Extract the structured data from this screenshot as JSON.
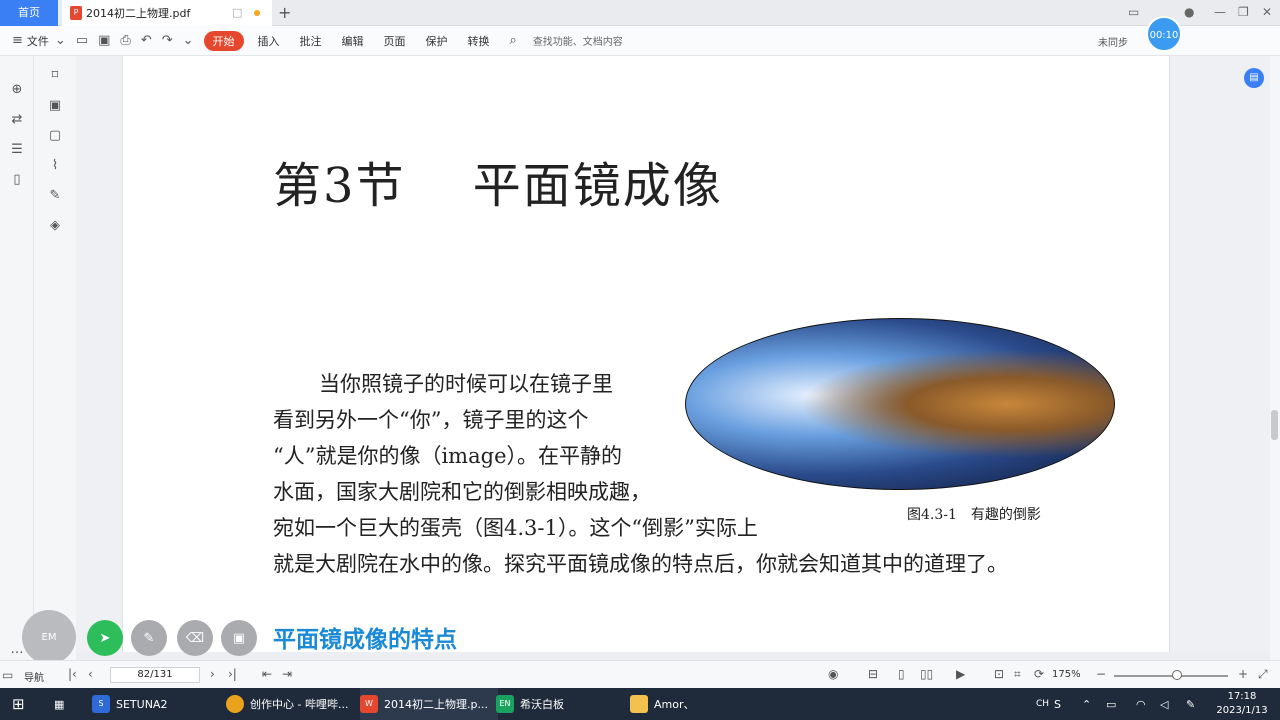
{
  "tabs": {
    "home": "首页",
    "document": "2014初二上物理.pdf"
  },
  "toolbar": {
    "file": "文件",
    "menu": [
      "开始",
      "插入",
      "批注",
      "编辑",
      "页面",
      "保护",
      "转换"
    ],
    "search_placeholder": "查找功能、文档内容",
    "sync": "未同步",
    "timer": "00:10"
  },
  "document": {
    "chapter_title": "第3节　 平面镜成像",
    "paragraph_lines": [
      "当你照镜子的时候可以在镜子里",
      "看到另外一个“你”，镜子里的这个",
      "“人”就是你的像（image）。在平静的",
      "水面，国家大剧院和它的倒影相映成趣，",
      "宛如一个巨大的蛋壳（图4.3-1）。这个“倒影”实际上",
      "就是大剧院在水中的像。探究平面镜成像的特点后，你就会知道其中的道理了。"
    ],
    "figure_caption": "图4.3-1　有趣的倒影",
    "section_heading": "平面镜成像的特点"
  },
  "statusbar": {
    "nav": "导航",
    "page": "82/131",
    "zoom": "175%"
  },
  "taskbar": {
    "items": [
      "SETUNA2",
      "创作中心 - 哔哩哔...",
      "2014初二上物理.p...",
      "希沃白板",
      "Amor、"
    ],
    "time": "17:18",
    "date": "2023/1/13",
    "lang": "CH"
  },
  "colors": {
    "accent": "#3b7ff5",
    "brand_red": "#e5482f",
    "heading_blue": "#1a8ad6",
    "dock_green": "#2dbd5a"
  }
}
